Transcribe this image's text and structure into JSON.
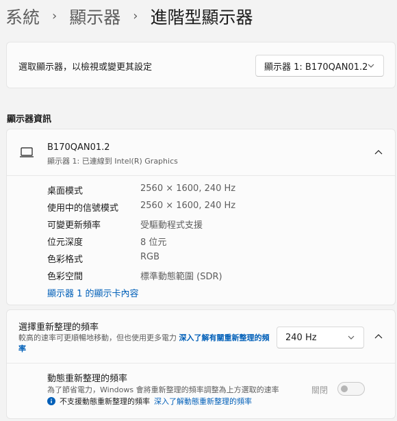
{
  "breadcrumb": {
    "items": [
      "系統",
      "顯示器"
    ],
    "separator": "›",
    "current": "進階型顯示器"
  },
  "select_display": {
    "label": "選取顯示器，以檢視或變更其設定",
    "selected": "顯示器 1: B170QAN01.2"
  },
  "display_info": {
    "section_title": "顯示器資訊",
    "name": "B170QAN01.2",
    "subtitle": "顯示器 1: 已連線到 Intel(R) Graphics",
    "rows": [
      {
        "key": "桌面模式",
        "value": "2560 × 1600, 240 Hz"
      },
      {
        "key": "使用中的信號模式",
        "value": "2560 × 1600, 240 Hz"
      },
      {
        "key": "可變更新頻率",
        "value": "受驅動程式支援"
      },
      {
        "key": "位元深度",
        "value": "8 位元"
      },
      {
        "key": "色彩格式",
        "value": "RGB"
      },
      {
        "key": "色彩空間",
        "value": "標準動態範圍 (SDR)"
      }
    ],
    "adapter_link": "顯示器 1 的顯示卡內容"
  },
  "refresh_rate": {
    "title": "選擇重新整理的頻率",
    "desc": "較高的速率可更順暢地移動，但也使用更多電力 ",
    "desc_link": "深入了解有關重新整理的頻率",
    "selected": "240 Hz",
    "dynamic": {
      "title": "動態重新整理的頻率",
      "desc": "為了節省電力，Windows 會將重新整理的頻率調整為上方選取的速率",
      "note": "不支援動態重新整理的頻率",
      "note_link": "深入了解動態重新整理的頻率",
      "toggle_label": "關閉",
      "toggle_on": false
    }
  },
  "colors": {
    "accent_link": "#005fb8",
    "background": "#f3f3f3",
    "card": "#fbfbfb"
  },
  "icons": [
    "laptop-icon",
    "chevron-down-icon",
    "chevron-up-icon",
    "info-icon"
  ]
}
